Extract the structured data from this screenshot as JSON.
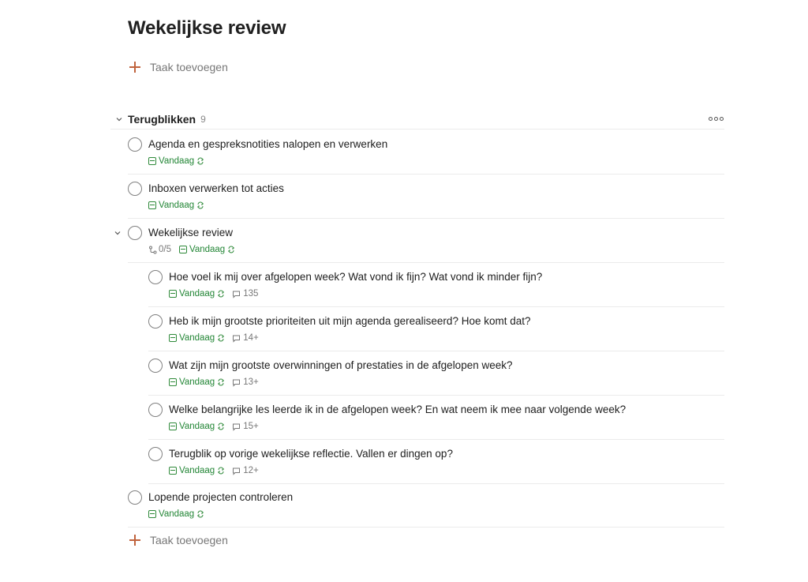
{
  "page": {
    "title": "Wekelijkse review"
  },
  "add_task_label": "Taak toevoegen",
  "section": {
    "title": "Terugblikken",
    "count": "9"
  },
  "tasks": [
    {
      "title": "Agenda en gespreksnotities nalopen en verwerken",
      "due": "Vandaag"
    },
    {
      "title": "Inboxen verwerken tot acties",
      "due": "Vandaag"
    },
    {
      "title": "Wekelijkse review",
      "due": "Vandaag",
      "subtasks": "0/5"
    },
    {
      "title": "Hoe voel ik mij over afgelopen week? Wat vond ik fijn? Wat vond ik minder fijn?",
      "due": "Vandaag",
      "comments": "135"
    },
    {
      "title": "Heb ik mijn grootste prioriteiten uit mijn agenda gerealiseerd? Hoe komt dat?",
      "due": "Vandaag",
      "comments": "14+"
    },
    {
      "title": "Wat zijn mijn grootste overwinningen of prestaties in de afgelopen week?",
      "due": "Vandaag",
      "comments": "13+"
    },
    {
      "title": "Welke belangrijke les leerde ik in de afgelopen week? En wat neem ik mee naar volgende week?",
      "due": "Vandaag",
      "comments": "15+"
    },
    {
      "title": "Terugblik op vorige wekelijkse reflectie. Vallen er dingen op?",
      "due": "Vandaag",
      "comments": "12+"
    },
    {
      "title": "Lopende projecten controleren",
      "due": "Vandaag"
    }
  ],
  "icons": {
    "add": "plus-icon",
    "collapse": "chevron-down-icon",
    "more": "more-horizontal-icon",
    "check": "checkbox-circle-icon",
    "due": "calendar-icon",
    "recurring": "repeat-icon",
    "comments": "comment-icon",
    "subtasks": "subtask-icon"
  },
  "colors": {
    "accent": "#c0633d",
    "due_today": "#238636",
    "divider": "#ebebeb",
    "muted": "#777777"
  }
}
